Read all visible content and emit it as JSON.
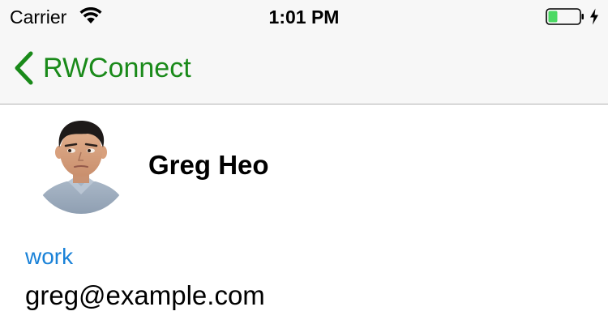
{
  "status_bar": {
    "carrier": "Carrier",
    "time": "1:01 PM",
    "battery_level": 0.3,
    "battery_fill_color": "#4cd964",
    "charging": true
  },
  "nav_bar": {
    "back_label": "RWConnect",
    "tint_color": "#1a8a1a"
  },
  "contact": {
    "name": "Greg Heo",
    "avatar": "profile-photo",
    "email_label": "work",
    "email_label_color": "#1a82d8",
    "email": "greg@example.com"
  }
}
